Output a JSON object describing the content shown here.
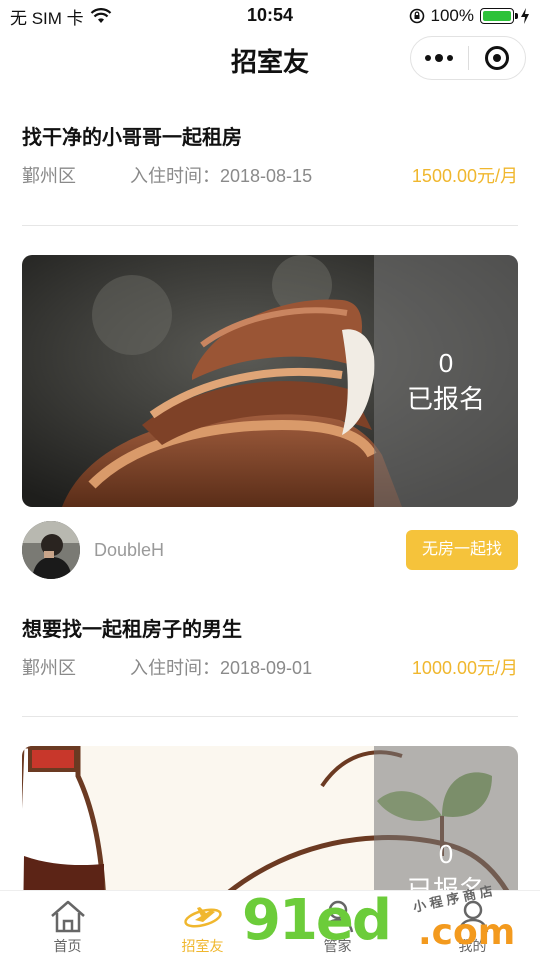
{
  "status_bar": {
    "carrier": "无 SIM 卡",
    "time": "10:54",
    "battery": "100%",
    "battery_level": 1.0
  },
  "nav": {
    "title": "招室友"
  },
  "posts": [
    {
      "title": "找干净的小哥哥一起租房",
      "district": "鄞州区",
      "move_in": "入住时间：2018-08-15",
      "price": "1500.00元/月",
      "signup_count": "0",
      "signup_label": "已报名",
      "author": "DoubleH",
      "tag": "无房一起找"
    },
    {
      "title": "想要找一起租房子的男生",
      "district": "鄞州区",
      "move_in": "入住时间：2018-09-01",
      "price": "1000.00元/月",
      "signup_count": "0",
      "signup_label": "已报名"
    }
  ],
  "tabs": [
    {
      "label": "首页",
      "icon": "home-icon"
    },
    {
      "label": "招室友",
      "icon": "roommate-icon"
    },
    {
      "label": "管家",
      "icon": "butler-icon"
    },
    {
      "label": "我的",
      "icon": "profile-icon"
    }
  ],
  "watermark": {
    "brand": "91ed",
    "domain": ".com",
    "slogan": "小程序商店"
  },
  "colors": {
    "accent": "#f0b72e",
    "button": "#f5c33b",
    "battery": "#2ec23a"
  }
}
